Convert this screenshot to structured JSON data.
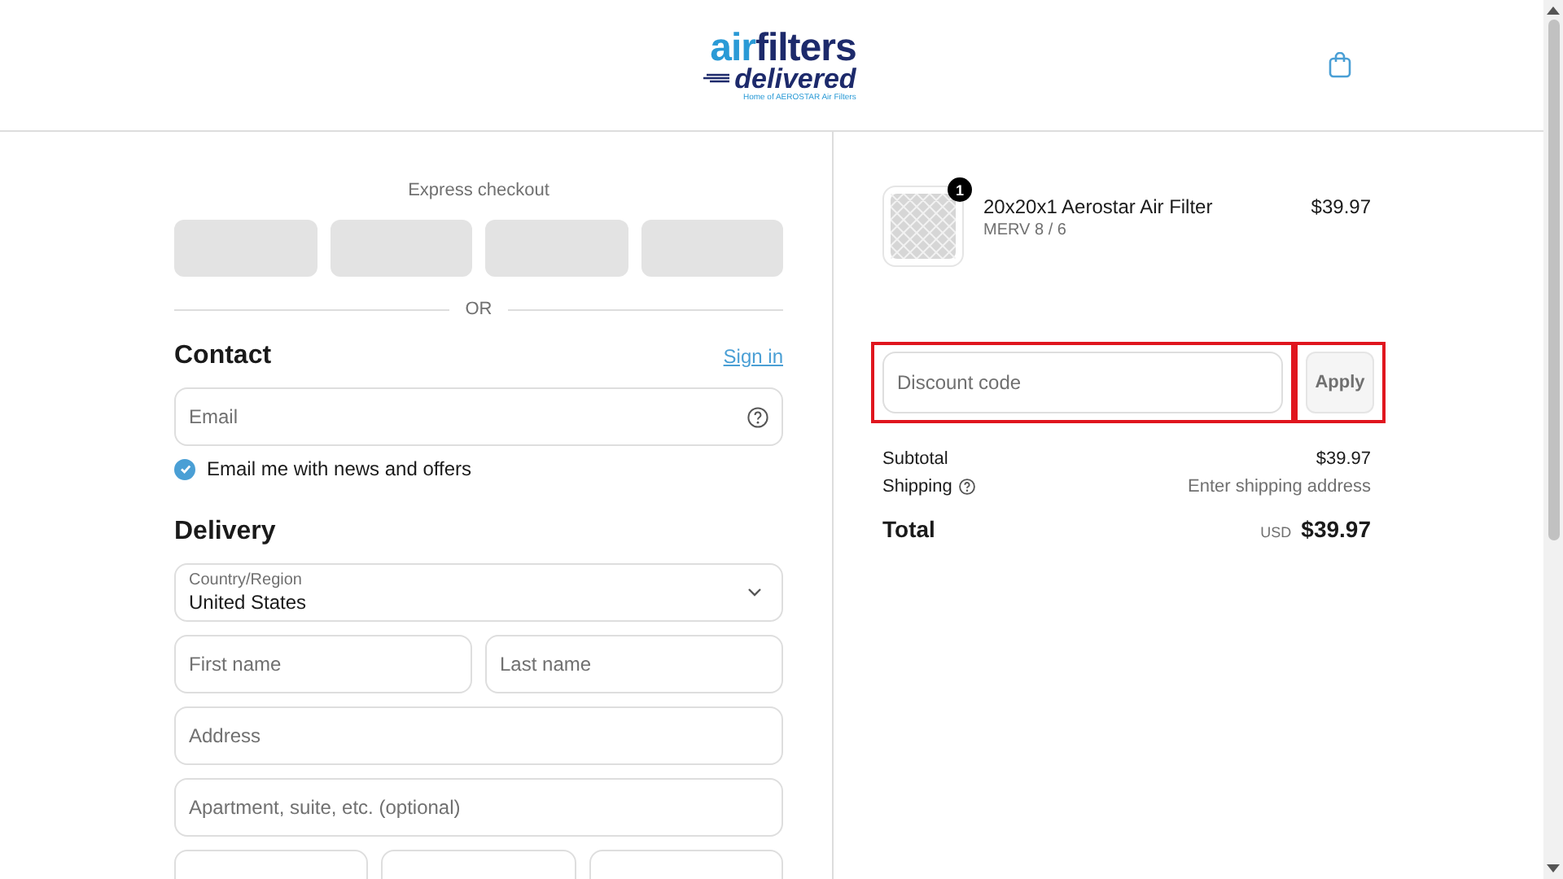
{
  "header": {
    "logo": {
      "word_1": "air",
      "word_2": "filters",
      "word_3": "delivered",
      "subtitle": "Home of AEROSTAR Air Filters"
    }
  },
  "express_checkout": {
    "title": "Express checkout",
    "buttons": [
      {
        "loading": true
      },
      {
        "loading": true
      },
      {
        "loading": true
      },
      {
        "loading": true
      }
    ],
    "divider_label": "OR"
  },
  "contact": {
    "title": "Contact",
    "sign_in": "Sign in",
    "email": {
      "placeholder": "Email"
    },
    "newsletter": {
      "label": "Email me with news and offers",
      "checked": true
    }
  },
  "delivery": {
    "title": "Delivery",
    "country": {
      "label": "Country/Region",
      "value": "United States"
    },
    "rows": [
      {
        "fields": [
          {
            "kind": "text",
            "placeholder": "First name"
          },
          {
            "kind": "text",
            "placeholder": "Last name"
          }
        ]
      },
      {
        "fields": [
          {
            "kind": "text",
            "placeholder": "Address"
          }
        ]
      },
      {
        "fields": [
          {
            "kind": "text",
            "placeholder": "Apartment, suite, etc. (optional)"
          }
        ]
      },
      {
        "fields": [
          {
            "kind": "partial"
          },
          {
            "kind": "partial"
          },
          {
            "kind": "partial"
          }
        ]
      }
    ]
  },
  "order": {
    "items": [
      {
        "name": "20x20x1 Aerostar Air Filter",
        "variant": "MERV 8 / 6",
        "price": "$39.97",
        "quantity": "1"
      }
    ],
    "discount": {
      "placeholder": "Discount code",
      "button": "Apply",
      "highlighted": true
    },
    "subtotal": {
      "label": "Subtotal",
      "value": "$39.97"
    },
    "shipping": {
      "label": "Shipping",
      "value": "Enter shipping address"
    },
    "total": {
      "label": "Total",
      "currency": "USD",
      "value": "$39.97"
    }
  }
}
